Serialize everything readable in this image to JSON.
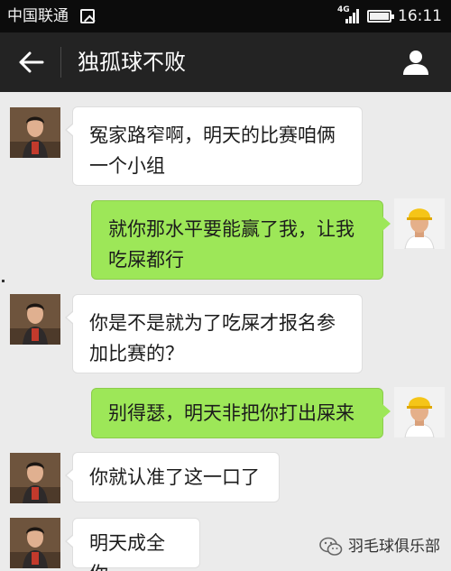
{
  "status_bar": {
    "carrier": "中国联通",
    "network": "4G",
    "time": "16:11"
  },
  "header": {
    "title": "独孤球不败"
  },
  "messages": [
    {
      "side": "in",
      "lines": [
        "冤家路窄啊，明天的比赛咱俩",
        "一个小组"
      ]
    },
    {
      "side": "out",
      "lines": [
        "就你那水平要能赢了我，让我",
        "吃屎都行"
      ]
    },
    {
      "side": "in",
      "lines": [
        "你是不是就为了吃屎才报名参",
        "加比赛的？"
      ]
    },
    {
      "side": "out",
      "lines": [
        "别得瑟，明天非把你打出屎来"
      ]
    },
    {
      "side": "in",
      "lines": [
        "你就认准了这一口了"
      ]
    },
    {
      "side": "in",
      "lines": [
        "明天成全你"
      ]
    }
  ],
  "watermark": {
    "text": "羽毛球俱乐部",
    "icon": "wechat-icon"
  },
  "colors": {
    "status_bar_bg": "#0c0c0c",
    "title_bar_bg": "#232323",
    "chat_bg": "#ebebeb",
    "outgoing_bubble": "#9de758",
    "incoming_bubble": "#ffffff"
  }
}
